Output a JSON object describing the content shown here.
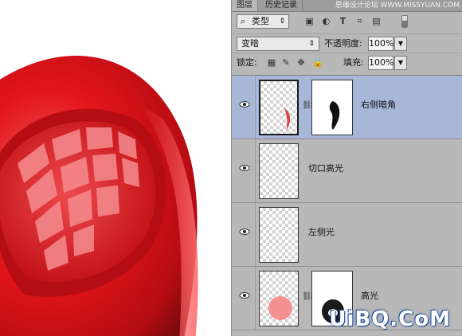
{
  "tabs": [
    {
      "label": "图层"
    },
    {
      "label": "历史记录"
    }
  ],
  "watermark_top": "思缘设计论坛 WWW.MISSYUAN.COM",
  "filter": {
    "kind_label": "类型",
    "icons": [
      "image-filter-icon",
      "adjustment-filter-icon",
      "type-filter-icon",
      "shape-filter-icon",
      "smart-object-filter-icon"
    ]
  },
  "blend": {
    "mode": "变暗",
    "opacity_label": "不透明度:",
    "opacity_value": "100%"
  },
  "lock": {
    "label": "锁定:",
    "fill_label": "填充:",
    "fill_value": "100%"
  },
  "layers": [
    {
      "name": "右侧暗角",
      "selected": true,
      "has_mask": true
    },
    {
      "name": "切口高光",
      "selected": false,
      "has_mask": false
    },
    {
      "name": "左侧光",
      "selected": false,
      "has_mask": false
    },
    {
      "name": "高光",
      "selected": false,
      "has_mask": true
    }
  ],
  "brand": "UiBQ.CoM",
  "colors": {
    "selected_layer": "#a6b7d8",
    "panel_bg": "#b8b8b8",
    "ball_red": "#e3141a"
  }
}
